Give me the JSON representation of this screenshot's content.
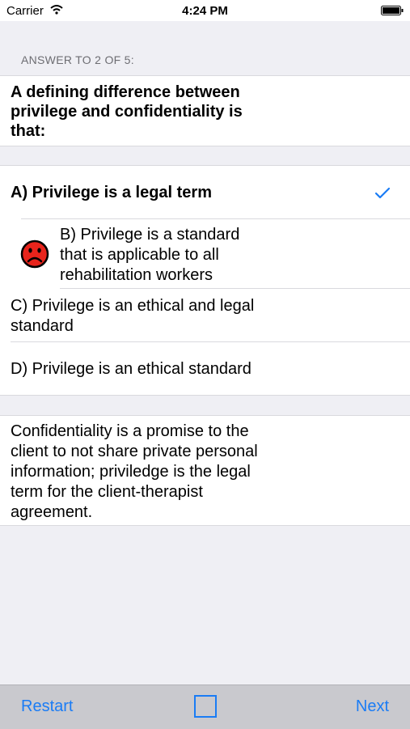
{
  "status_bar": {
    "carrier": "Carrier",
    "time": "4:24 PM",
    "wifi_icon": "wifi-icon",
    "battery_icon": "battery-icon"
  },
  "section_header": "ANSWER TO 2 OF 5:",
  "question": "A defining difference between privilege and confidentiality is that:",
  "answers": [
    {
      "label": "A) Privilege is a legal term",
      "selected": true,
      "icon": "checkmark-icon"
    },
    {
      "label": "B) Privilege is a standard that is applicable to all rehabilitation workers",
      "icon": "sad-face-icon"
    },
    {
      "label": "C) Privilege is an ethical and legal standard"
    },
    {
      "label": "D) Privilege is an ethical standard"
    }
  ],
  "explanation": "Confidentiality is a promise to the client to not share private personal information; priviledge is the legal term for the client-therapist agreement.",
  "toolbar": {
    "restart_label": "Restart",
    "next_label": "Next",
    "center_icon": "square-icon"
  },
  "colors": {
    "accent": "#1a7cf5",
    "background": "#efeff4",
    "toolbar": "#c9c9ce",
    "sad_face": "#e8241c"
  }
}
